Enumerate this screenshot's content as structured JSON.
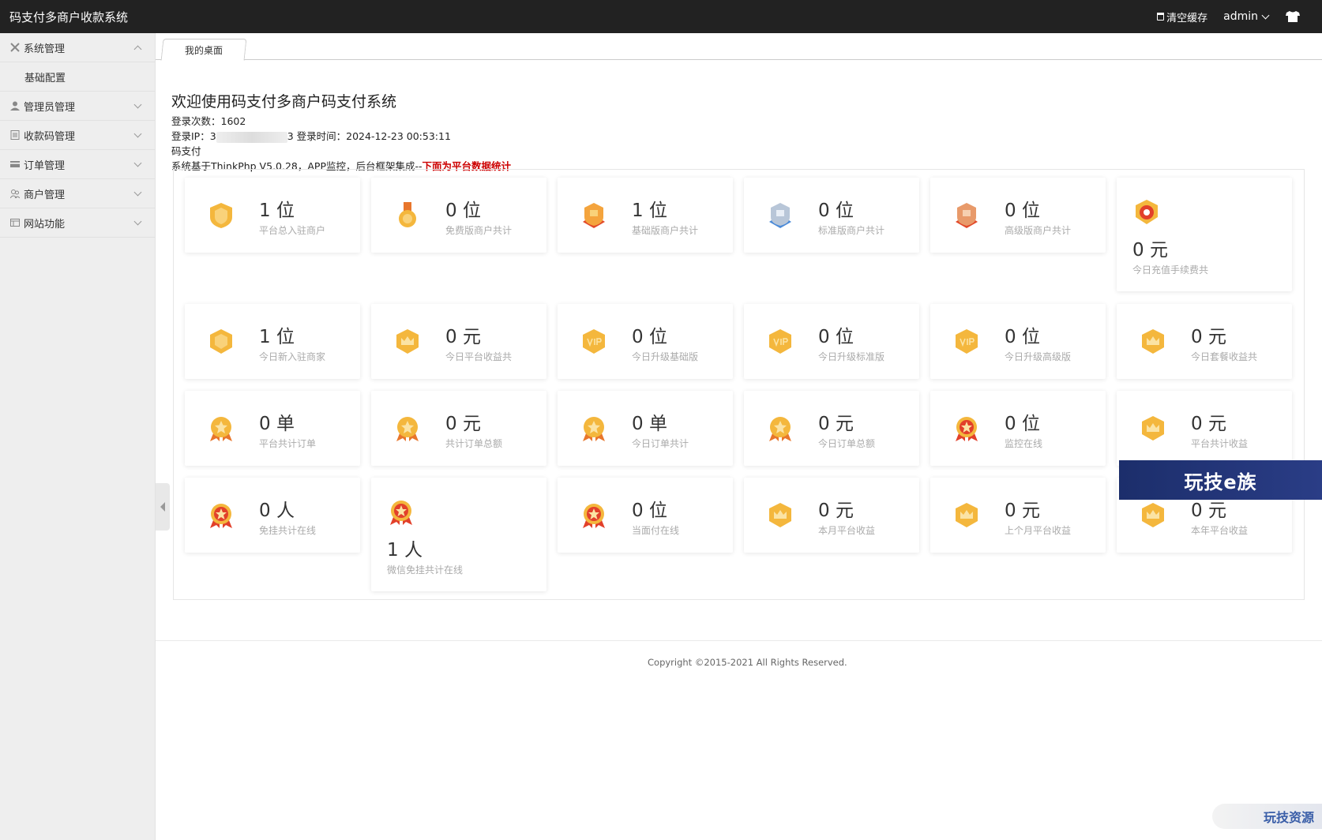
{
  "app": {
    "title": "码支付多商户收款系统"
  },
  "header": {
    "clear_cache": "清空缓存",
    "user": "admin"
  },
  "sidebar": {
    "items": [
      {
        "label": "系统管理",
        "icon": "tools-icon",
        "expanded": true,
        "children": [
          "基础配置"
        ]
      },
      {
        "label": "管理员管理",
        "icon": "user-icon"
      },
      {
        "label": "收款码管理",
        "icon": "document-icon"
      },
      {
        "label": "订单管理",
        "icon": "card-icon"
      },
      {
        "label": "商户管理",
        "icon": "users-icon"
      },
      {
        "label": "网站功能",
        "icon": "window-icon"
      }
    ]
  },
  "tabs": [
    {
      "label": "我的桌面"
    }
  ],
  "welcome": {
    "title": "欢迎使用码支付多商户码支付系统",
    "login_count_label": "登录次数：",
    "login_count": "1602",
    "login_ip_label": "登录IP：",
    "login_ip_prefix": "3",
    "login_ip_suffix": "3",
    "login_time_label": "登录时间：",
    "login_time": "2024-12-23 00:53:11",
    "product": "码支付",
    "framework_text": "系统基于ThinkPhp V5.0.28，APP监控，后台框架集成--",
    "framework_highlight": "下面为平台数据统计"
  },
  "stats": [
    {
      "value": "1 位",
      "label": "平台总入驻商户",
      "icon": "shield-gold-icon"
    },
    {
      "value": "0 位",
      "label": "免费版商户共计",
      "icon": "medal-gold-icon"
    },
    {
      "value": "1 位",
      "label": "基础版商户共计",
      "icon": "shield-bronze-icon"
    },
    {
      "value": "0 位",
      "label": "标准版商户共计",
      "icon": "shield-silver-icon"
    },
    {
      "value": "0 位",
      "label": "高级版商户共计",
      "icon": "shield-red-icon"
    },
    {
      "value": "0 元",
      "label": "今日充值手续费共",
      "icon": "badge-red-icon"
    },
    {
      "value": "1 位",
      "label": "今日新入驻商家",
      "icon": "hex-gold-icon"
    },
    {
      "value": "0 元",
      "label": "今日平台收益共",
      "icon": "hex-crown-icon"
    },
    {
      "value": "0 位",
      "label": "今日升级基础版",
      "icon": "vip-icon"
    },
    {
      "value": "0 位",
      "label": "今日升级标准版",
      "icon": "vip-icon"
    },
    {
      "value": "0 位",
      "label": "今日升级高级版",
      "icon": "vip-icon"
    },
    {
      "value": "0 元",
      "label": "今日套餐收益共",
      "icon": "hex-crown-icon"
    },
    {
      "value": "0 单",
      "label": "平台共计订单",
      "icon": "star-medal-gold-icon"
    },
    {
      "value": "0 元",
      "label": "共计订单总额",
      "icon": "star-medal-gold-icon"
    },
    {
      "value": "0 单",
      "label": "今日订单共计",
      "icon": "star-medal-gold-icon"
    },
    {
      "value": "0 元",
      "label": "今日订单总额",
      "icon": "star-medal-gold-icon"
    },
    {
      "value": "0 位",
      "label": "监控在线",
      "icon": "star-medal-red-icon"
    },
    {
      "value": "0 元",
      "label": "平台共计收益",
      "icon": "hex-crown-icon"
    },
    {
      "value": "0 人",
      "label": "免挂共计在线",
      "icon": "star-medal-red-icon"
    },
    {
      "value": "1 人",
      "label": "微信免挂共计在线",
      "icon": "star-medal-red-icon"
    },
    {
      "value": "0 位",
      "label": "当面付在线",
      "icon": "star-medal-red-icon"
    },
    {
      "value": "0 元",
      "label": "本月平台收益",
      "icon": "hex-crown-icon"
    },
    {
      "value": "0 元",
      "label": "上个月平台收益",
      "icon": "hex-crown-icon"
    },
    {
      "value": "0 元",
      "label": "本年平台收益",
      "icon": "hex-crown-icon"
    }
  ],
  "footer": {
    "copyright": "Copyright ©2015-2021 All Rights Reserved."
  },
  "watermarks": {
    "banner": "玩技e族",
    "badge": "玩技资源"
  },
  "colors": {
    "topbar": "#222222",
    "sidebar": "#eeeeee",
    "highlight": "#cc0000",
    "gold": "#f2b33d"
  }
}
